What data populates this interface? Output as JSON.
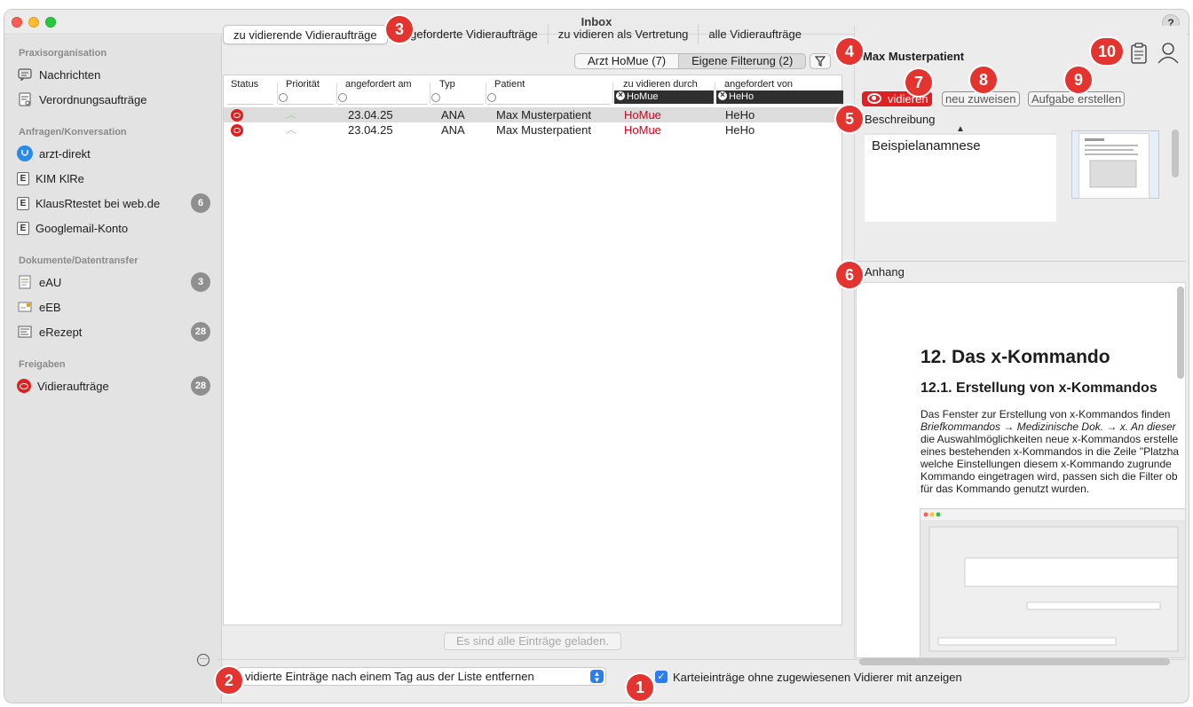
{
  "window": {
    "title": "Inbox",
    "help": "?"
  },
  "sidebar": {
    "sections": [
      {
        "title": "Praxisorganisation",
        "items": [
          {
            "label": "Nachrichten",
            "icon": "message-icon",
            "badge": ""
          },
          {
            "label": "Verordnungsaufträge",
            "icon": "prescription-order-icon",
            "badge": ""
          }
        ]
      },
      {
        "title": "Anfragen/Konversation",
        "items": [
          {
            "label": "arzt-direkt",
            "icon": "stethoscope-icon",
            "badge": ""
          },
          {
            "label": "KIM KlRe",
            "icon": "e-icon",
            "badge": ""
          },
          {
            "label": "KlausRtestet bei web.de",
            "icon": "e-icon",
            "badge": "6"
          },
          {
            "label": "Googlemail-Konto",
            "icon": "e-icon",
            "badge": ""
          }
        ]
      },
      {
        "title": "Dokumente/Datentransfer",
        "items": [
          {
            "label": "eAU",
            "icon": "document-icon",
            "badge": "3"
          },
          {
            "label": "eEB",
            "icon": "envelope-icon",
            "badge": ""
          },
          {
            "label": "eRezept",
            "icon": "prescription-icon",
            "badge": "28"
          }
        ]
      },
      {
        "title": "Freigaben",
        "items": [
          {
            "label": "Vidieraufträge",
            "icon": "eye-icon",
            "badge": "28"
          }
        ]
      }
    ]
  },
  "tabs": [
    {
      "label": "zu vidierende Vidieraufträge",
      "active": true
    },
    {
      "label": "angeforderte Vidieraufträge",
      "active": false
    },
    {
      "label": "zu vidieren als Vertretung",
      "active": false
    },
    {
      "label": "alle Vidieraufträge",
      "active": false
    }
  ],
  "filters": {
    "arzt": "Arzt HoMue (7)",
    "eigene": "Eigene Filterung (2)"
  },
  "table": {
    "headers": [
      "Status",
      "Priorität",
      "angefordert am",
      "Typ",
      "Patient",
      "zu vidieren durch",
      "angefordert von"
    ],
    "header_filters": {
      "zu_vidieren_durch": "HoMue",
      "angefordert_von": "HeHo"
    },
    "rows": [
      {
        "date": "23.04.25",
        "typ": "ANA",
        "patient": "Max Musterpatient",
        "durch": "HoMue",
        "von": "HeHo",
        "selected": true
      },
      {
        "date": "23.04.25",
        "typ": "ANA",
        "patient": "Max Musterpatient",
        "durch": "HoMue",
        "von": "HeHo",
        "selected": false
      }
    ],
    "footer": "Es sind alle Einträge geladen."
  },
  "bottom": {
    "select_value": "vidierte Einträge nach einem Tag aus der Liste entfernen",
    "checkbox_label": "Karteieinträge ohne zugewiesenen Vidierer mit anzeigen",
    "checkbox_checked": true
  },
  "detail": {
    "patient": "Max Musterpatient",
    "buttons": {
      "vidieren": "vidieren",
      "neu_zuweisen": "neu zuweisen",
      "aufgabe": "Aufgabe erstellen"
    },
    "beschreibung_label": "Beschreibung",
    "beschreibung_text": "Beispielanamnese",
    "anhang_label": "Anhang",
    "doc": {
      "h1": "12. Das x-Kommando",
      "h2": "12.1. Erstellung von x-Kommandos",
      "lines": [
        "Das Fenster zur Erstellung von x-Kommandos finden",
        "Briefkommandos → Medizinische Dok. → x. An dieser",
        "die Auswahlmöglichkeiten neue x-Kommandos erstelle",
        "eines bestehenden x-Kommandos in die Zeile \"Platzha",
        "welche Einstellungen diesem x-Kommando zugrunde",
        "Kommando eingetragen wird, passen sich die Filter ob",
        "für das Kommando genutzt wurden."
      ]
    }
  },
  "markers": [
    "1",
    "2",
    "3",
    "4",
    "5",
    "6",
    "7",
    "8",
    "9",
    "10"
  ],
  "colors": {
    "accent_red": "#e02020",
    "marker_red": "#e3342f",
    "accent_blue": "#2a7ef5"
  }
}
